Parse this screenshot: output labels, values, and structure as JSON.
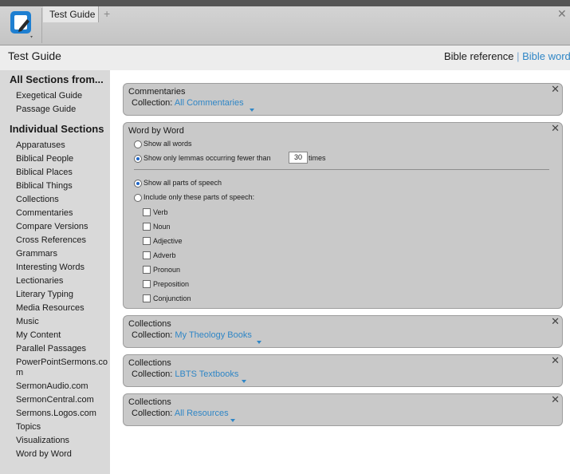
{
  "window": {
    "tab_label": "Test Guide",
    "new_tab_glyph": "+",
    "close_glyph": "✕",
    "app_icon": "guide-editor-icon"
  },
  "header": {
    "title": "Test Guide",
    "reference_label": "Bible reference",
    "separator": "|",
    "word_label": "Bible word"
  },
  "sidebar": {
    "heading_all": "All Sections from...",
    "all_items": [
      "Exegetical Guide",
      "Passage Guide"
    ],
    "heading_individual": "Individual Sections",
    "individual_items": [
      "Apparatuses",
      "Biblical People",
      "Biblical Places",
      "Biblical Things",
      "Collections",
      "Commentaries",
      "Compare Versions",
      "Cross References",
      "Grammars",
      "Interesting Words",
      "Lectionaries",
      "Literary Typing",
      "Media Resources",
      "Music",
      "My Content",
      "Parallel Passages",
      "PowerPointSermons.co",
      "m",
      "SermonAudio.com",
      "SermonCentral.com",
      "Sermons.Logos.com",
      "Topics",
      "Visualizations",
      "Word by Word"
    ]
  },
  "panels": {
    "commentaries": {
      "title": "Commentaries",
      "collection_label": "Collection:",
      "collection_value": "All Commentaries",
      "close": "✕"
    },
    "word_by_word": {
      "title": "Word by Word",
      "close": "✕",
      "show_all_words": "Show all words",
      "show_only_lemmas": "Show only lemmas occurring fewer than",
      "lemma_count": "30",
      "times": "times",
      "show_all_pos": "Show all parts of speech",
      "include_only_pos": "Include only these parts of speech:",
      "parts_of_speech": [
        "Verb",
        "Noun",
        "Adjective",
        "Adverb",
        "Pronoun",
        "Preposition",
        "Conjunction"
      ]
    },
    "collections_1": {
      "title": "Collections",
      "collection_label": "Collection:",
      "collection_value": "My Theology Books",
      "close": "✕"
    },
    "collections_2": {
      "title": "Collections",
      "collection_label": "Collection:",
      "collection_value": "LBTS Textbooks",
      "close": "✕"
    },
    "collections_3": {
      "title": "Collections",
      "collection_label": "Collection:",
      "collection_value": "All Resources",
      "close": "✕"
    }
  },
  "colors": {
    "link": "#2f86c6",
    "panel_bg": "#c9c9c9",
    "sidebar_bg": "#d9d9d9"
  }
}
